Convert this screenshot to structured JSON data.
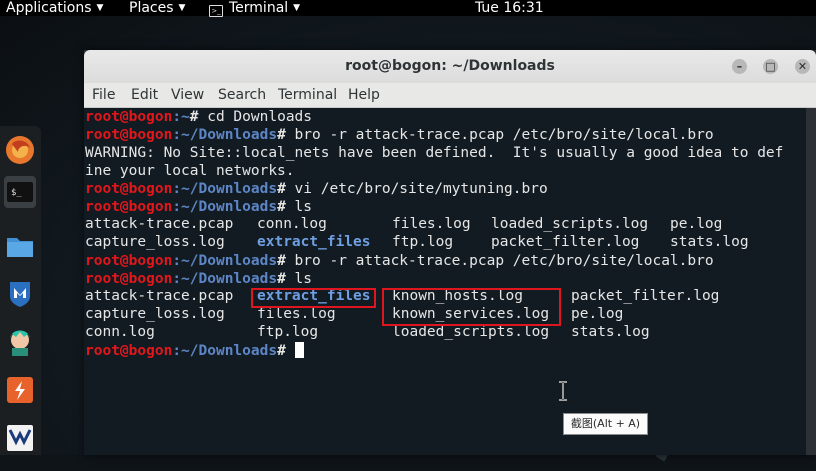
{
  "top_panel": {
    "applications": "Applications",
    "places": "Places",
    "terminal": "Terminal",
    "clock": "Tue 16:31"
  },
  "dock": {
    "icons": [
      "firefox-icon",
      "terminal-icon",
      "files-icon",
      "metasploit-icon",
      "armitage-icon",
      "burpsuite-icon",
      "app-icon"
    ]
  },
  "window": {
    "title": "root@bogon: ~/Downloads",
    "buttons": {
      "minimize": "–",
      "maximize": "□",
      "close": "✕"
    },
    "menu": [
      "File",
      "Edit",
      "View",
      "Search",
      "Terminal",
      "Help"
    ]
  },
  "terminal": {
    "prompt_user": "root@bogon",
    "home_path": ":~",
    "dl_path": ":~/Downloads",
    "prompt_char": "#",
    "cmd1": " cd Downloads",
    "cmd2": " bro -r attack-trace.pcap /etc/bro/site/local.bro",
    "warning1": "WARNING: No Site::local_nets have been defined.  It's usually a good idea to def",
    "warning2": "ine your local networks.",
    "cmd3": " vi /etc/bro/site/mytuning.bro",
    "cmd4": " ls",
    "ls1": {
      "c1": [
        "attack-trace.pcap",
        "capture_loss.log"
      ],
      "c2": [
        "conn.log",
        "extract_files"
      ],
      "c3": [
        "files.log",
        "ftp.log"
      ],
      "c4": [
        "loaded_scripts.log",
        "packet_filter.log"
      ],
      "c5": [
        "pe.log",
        "stats.log"
      ]
    },
    "cmd5": " bro -r attack-trace.pcap /etc/bro/site/local.bro",
    "cmd6": " ls",
    "ls2": {
      "c1": [
        "attack-trace.pcap",
        "capture_loss.log",
        "conn.log"
      ],
      "c2": [
        "extract_files",
        "files.log",
        "ftp.log"
      ],
      "c3": [
        "known_hosts.log",
        "known_services.log",
        "loaded_scripts.log"
      ],
      "c4": [
        "packet_filter.log",
        "pe.log",
        "stats.log"
      ]
    }
  },
  "tooltip": "截图(Alt + A)"
}
